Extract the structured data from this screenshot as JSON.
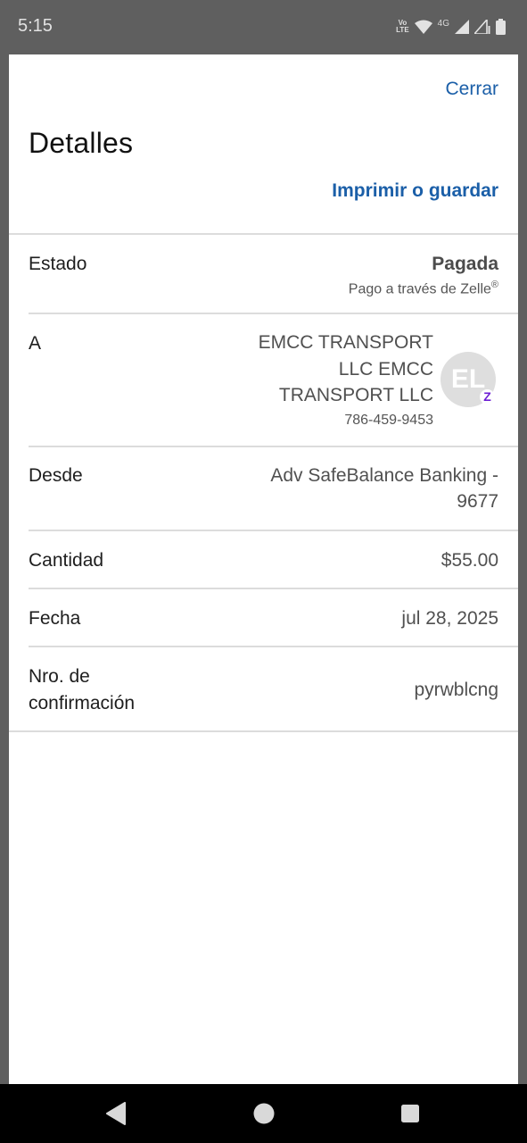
{
  "status_bar": {
    "time": "5:15",
    "network_label": "4G",
    "volte_top": "Vo",
    "volte_bottom": "LTE"
  },
  "header": {
    "close_label": "Cerrar",
    "title": "Detalles",
    "print_label": "Imprimir o guardar"
  },
  "details": {
    "status": {
      "label": "Estado",
      "value": "Pagada",
      "sub": "Pago a través de Zelle",
      "sub_mark": "®"
    },
    "recipient": {
      "label": "A",
      "name": "EMCC TRANSPORT LLC EMCC TRANSPORT LLC",
      "phone": "786-459-9453",
      "avatar_initials": "EL",
      "avatar_badge": "Z"
    },
    "from": {
      "label": "Desde",
      "value": "Adv SafeBalance Banking - 9677"
    },
    "amount": {
      "label": "Cantidad",
      "value": "$55.00"
    },
    "date": {
      "label": "Fecha",
      "value": "jul 28, 2025"
    },
    "confirmation": {
      "label": "Nro. de confirmación",
      "value": "pyrwblcng"
    }
  },
  "colors": {
    "link": "#1b5fa8",
    "zelle_badge": "#6d1ed4",
    "status_bar": "#5f5f5f",
    "nav_bar": "#000000"
  },
  "nav_icons": [
    "back-icon",
    "home-icon",
    "recents-icon"
  ]
}
